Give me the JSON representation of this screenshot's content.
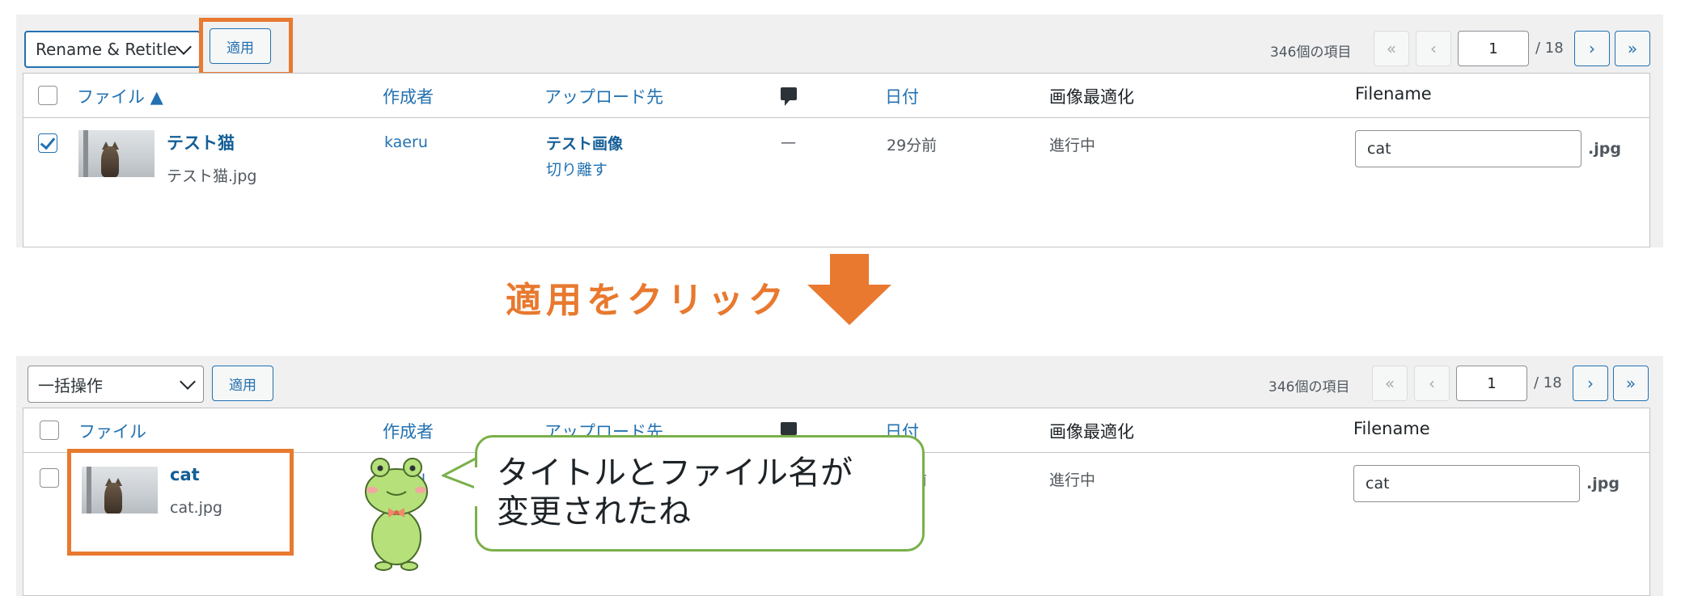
{
  "before": {
    "bulk_action": "Rename & Retitle",
    "apply_label": "適用",
    "item_count": "346個の項目",
    "pagination": {
      "first": "«",
      "prev": "‹",
      "current": "1",
      "total": "/ 18",
      "next": "›",
      "last": "»"
    },
    "columns": {
      "file": "ファイル ▲",
      "author": "作成者",
      "uploaded_to": "アップロード先",
      "date": "日付",
      "optimize": "画像最適化",
      "filename": "Filename"
    },
    "row": {
      "checked": true,
      "title": "テスト猫",
      "file": "テスト猫.jpg",
      "author": "kaeru",
      "uploaded_to": "テスト画像",
      "detach": "切り離す",
      "comments": "—",
      "date": "29分前",
      "optimize_status": "進行中",
      "filename_value": "cat",
      "extension": ".jpg"
    }
  },
  "annotation": {
    "caption": "適用をクリック",
    "arrow_color": "#e8792f"
  },
  "after": {
    "bulk_action": "一括操作",
    "apply_label": "適用",
    "item_count": "346個の項目",
    "pagination": {
      "first": "«",
      "prev": "‹",
      "current": "1",
      "total": "/ 18",
      "next": "›",
      "last": "»"
    },
    "columns": {
      "file": "ファイル",
      "author": "作成者",
      "uploaded_to": "アップロード先",
      "date": "日付",
      "optimize": "画像最適化",
      "filename": "Filename"
    },
    "row": {
      "checked": false,
      "title": "cat",
      "file": "cat.jpg",
      "author_partial": "u",
      "date_partial": "前",
      "optimize_status": "進行中",
      "filename_value": "cat",
      "extension": ".jpg"
    }
  },
  "bubble": {
    "line1": "タイトルとファイル名が",
    "line2": "変更されたね"
  },
  "colors": {
    "accent": "#e8792f",
    "wp_blue": "#2271b1",
    "bubble_border": "#7ab04a",
    "frog": "#b6e07a"
  }
}
